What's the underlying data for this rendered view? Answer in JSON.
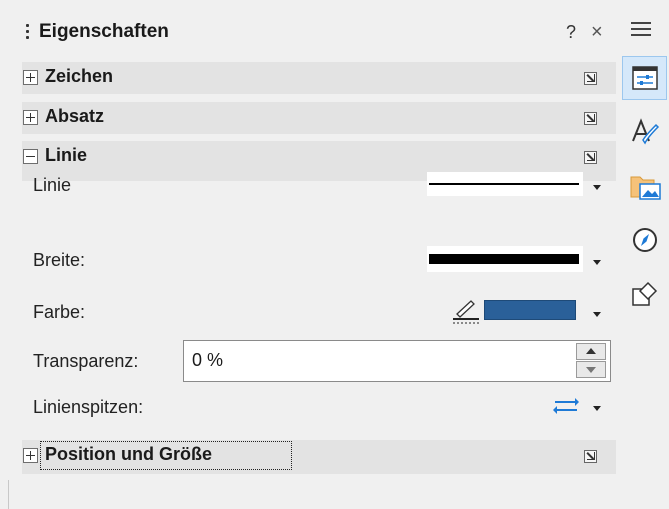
{
  "panel": {
    "title": "Eigenschaften",
    "help_label": "?",
    "close_label": "×"
  },
  "sections": {
    "zeichen": {
      "title": "Zeichen",
      "expanded": false
    },
    "absatz": {
      "title": "Absatz",
      "expanded": false
    },
    "linie": {
      "title": "Linie",
      "expanded": true
    },
    "position": {
      "title": "Position und Größe",
      "expanded": false
    }
  },
  "line": {
    "style_label": "Linie",
    "width_label": "Breite:",
    "color_label": "Farbe:",
    "color_value": "#2a6099",
    "transparency_label": "Transparenz:",
    "transparency_value": "0 %",
    "arrow_label": "Linienspitzen:"
  },
  "sidebar_tabs": [
    {
      "name": "properties-icon",
      "active": true
    },
    {
      "name": "styles-icon",
      "active": false
    },
    {
      "name": "gallery-icon",
      "active": false
    },
    {
      "name": "navigator-icon",
      "active": false
    },
    {
      "name": "shapes-icon",
      "active": false
    }
  ],
  "colors": {
    "accent": "#2a6099",
    "active_tab": "#d5e8fa",
    "section_header": "#e3e3e3"
  }
}
